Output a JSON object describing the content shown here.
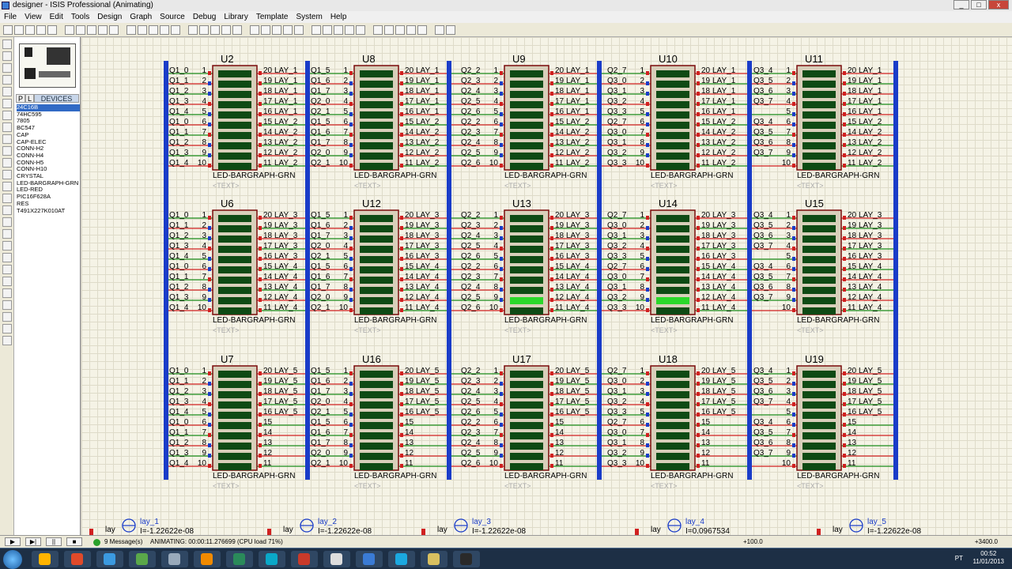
{
  "window": {
    "title": "designer - ISIS Professional (Animating)"
  },
  "menu": [
    "File",
    "View",
    "Edit",
    "Tools",
    "Design",
    "Graph",
    "Source",
    "Debug",
    "Library",
    "Template",
    "System",
    "Help"
  ],
  "sidebar": {
    "tab_p": "P",
    "tab_l": "L",
    "devices_label": "DEVICES",
    "devices": [
      "24C16B",
      "74HC595",
      "7805",
      "BC547",
      "CAP",
      "CAP-ELEC",
      "CONN-H2",
      "CONN-H4",
      "CONN-H5",
      "CONN-H10",
      "CRYSTAL",
      "LED-BARGRAPH-GRN",
      "LED-RED",
      "PIC16F628A",
      "RES",
      "T491X227K010AT"
    ],
    "selected": "24C16B"
  },
  "schematic": {
    "part_type": "LED-BARGRAPH-GRN",
    "text_placeholder": "<TEXT>",
    "rows": [
      {
        "units": [
          "U2",
          "U8",
          "U9",
          "U10",
          "U11"
        ],
        "lay_a": "LAY_1",
        "lay_b": "LAY_2"
      },
      {
        "units": [
          "U6",
          "U12",
          "U13",
          "U14",
          "U15"
        ],
        "lay_a": "LAY_3",
        "lay_b": "LAY_4"
      },
      {
        "units": [
          "U7",
          "U16",
          "U17",
          "U18",
          "U19"
        ],
        "lay_a": "LAY_5",
        "lay_b": ""
      }
    ],
    "column_left_labels": [
      [
        "Q1_0",
        "Q1_1",
        "Q1_2",
        "Q1_3",
        "Q1_4",
        "Q1_0",
        "Q1_1",
        "Q1_2",
        "Q1_3",
        "Q1_4"
      ],
      [
        "Q1_5",
        "Q1_6",
        "Q1_7",
        "Q2_0",
        "Q2_1",
        "Q1_5",
        "Q1_6",
        "Q1_7",
        "Q2_0",
        "Q2_1"
      ],
      [
        "Q2_2",
        "Q2_3",
        "Q2_4",
        "Q2_5",
        "Q2_6",
        "Q2_2",
        "Q2_3",
        "Q2_4",
        "Q2_5",
        "Q2_6"
      ],
      [
        "Q2_7",
        "Q3_0",
        "Q3_1",
        "Q3_2",
        "Q3_3",
        "Q2_7",
        "Q3_0",
        "Q3_1",
        "Q3_2",
        "Q3_3"
      ],
      [
        "Q3_4",
        "Q3_5",
        "Q3_6",
        "Q3_7",
        "",
        "Q3_4",
        "Q3_5",
        "Q3_6",
        "Q3_7",
        ""
      ]
    ],
    "lit_segments": [
      [],
      [],
      [],
      [],
      [],
      [],
      [],
      [
        8
      ],
      [
        8
      ],
      [],
      [],
      [],
      [],
      [],
      []
    ],
    "probes": [
      {
        "name": "lay_1",
        "value": "I=-1.22622e-08",
        "label": "lay_1"
      },
      {
        "name": "lay_2",
        "value": "I=-1.22622e-08",
        "label": "lay_2"
      },
      {
        "name": "lay_3",
        "value": "I=-1.22622e-08",
        "label": "lay_3"
      },
      {
        "name": "lay_4",
        "value": "I=0.0967534",
        "label": "lay_4"
      },
      {
        "name": "lay_5",
        "value": "I=-1.22622e-08",
        "label": "lay_5"
      }
    ]
  },
  "status": {
    "messages": "9 Message(s)",
    "animating": "ANIMATING: 00:00:11.276699 (CPU load 71%)",
    "coord_x": "+100.0",
    "coord_y": "+3400.0"
  },
  "taskbar": {
    "lang": "PT",
    "time": "00:52",
    "date": "11/01/2013"
  }
}
